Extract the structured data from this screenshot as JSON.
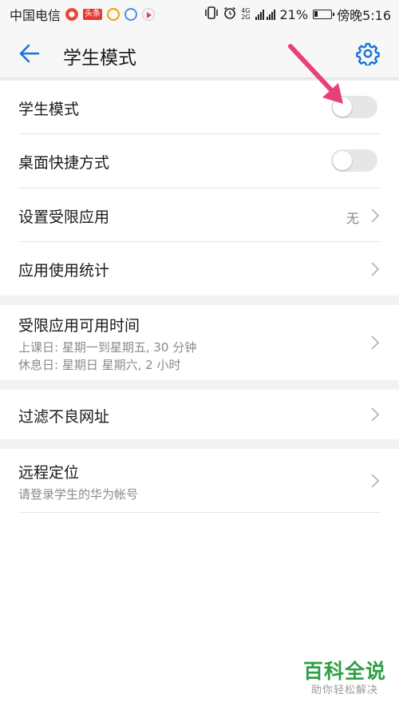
{
  "status_bar": {
    "carrier": "中国电信",
    "notif_badge": "头条",
    "battery": "21%",
    "battery_level": 0.21,
    "time": "傍晚5:16",
    "net_top": "4G",
    "net_bottom": "2G"
  },
  "header": {
    "title": "学生模式",
    "back_icon": "arrow-left-icon",
    "settings_icon": "gear-icon",
    "accent": "#1a73d9"
  },
  "items": {
    "student_mode": {
      "title": "学生模式",
      "enabled": false
    },
    "desktop_shortcut": {
      "title": "桌面快捷方式",
      "enabled": false
    },
    "restricted_apps": {
      "title": "设置受限应用",
      "value": "无"
    },
    "app_usage": {
      "title": "应用使用统计"
    },
    "available_time": {
      "title": "受限应用可用时间",
      "line1": "上课日: 星期一到星期五, 30 分钟",
      "line2": "休息日: 星期日 星期六, 2 小时"
    },
    "filter_urls": {
      "title": "过滤不良网址"
    },
    "remote_location": {
      "title": "远程定位",
      "subtitle": "请登录学生的华为帐号"
    }
  },
  "annotation": {
    "color": "#e8407a"
  },
  "watermark": {
    "title": "百科全说",
    "subtitle": "助你轻松解决"
  }
}
